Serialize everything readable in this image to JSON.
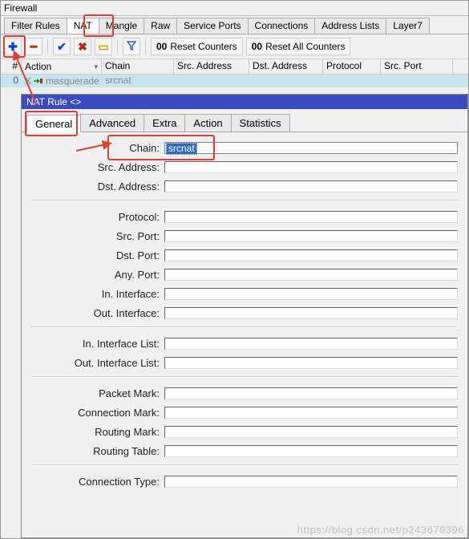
{
  "window": {
    "title": "Firewall"
  },
  "tabs": {
    "filter_rules": "Filter Rules",
    "nat": "NAT",
    "mangle": "Mangle",
    "raw": "Raw",
    "service_ports": "Service Ports",
    "connections": "Connections",
    "address_lists": "Address Lists",
    "layer7": "Layer7"
  },
  "toolbar": {
    "reset_counters": "Reset Counters",
    "reset_all_counters": "Reset All Counters",
    "counter_prefix": "00"
  },
  "grid": {
    "columns": {
      "num": "#",
      "action": "Action",
      "chain": "Chain",
      "src_addr": "Src. Address",
      "dst_addr": "Dst. Address",
      "protocol": "Protocol",
      "src_port": "Src. Port"
    },
    "row0": {
      "num": "0",
      "flag": "X",
      "action": "masquerade",
      "chain": "srcnat"
    }
  },
  "dialog": {
    "title": "NAT Rule <>",
    "tabs": {
      "general": "General",
      "advanced": "Advanced",
      "extra": "Extra",
      "action": "Action",
      "statistics": "Statistics"
    },
    "labels": {
      "chain": "Chain:",
      "src_addr": "Src. Address:",
      "dst_addr": "Dst. Address:",
      "protocol": "Protocol:",
      "src_port": "Src. Port:",
      "dst_port": "Dst. Port:",
      "any_port": "Any. Port:",
      "in_iface": "In. Interface:",
      "out_iface": "Out. Interface:",
      "in_iface_list": "In. Interface List:",
      "out_iface_list": "Out. Interface List:",
      "packet_mark": "Packet Mark:",
      "connection_mark": "Connection Mark:",
      "routing_mark": "Routing Mark:",
      "routing_table": "Routing Table:",
      "connection_type": "Connection Type:"
    },
    "values": {
      "chain": "srcnat"
    }
  },
  "watermark": "https://blog.csdn.net/p243679396"
}
